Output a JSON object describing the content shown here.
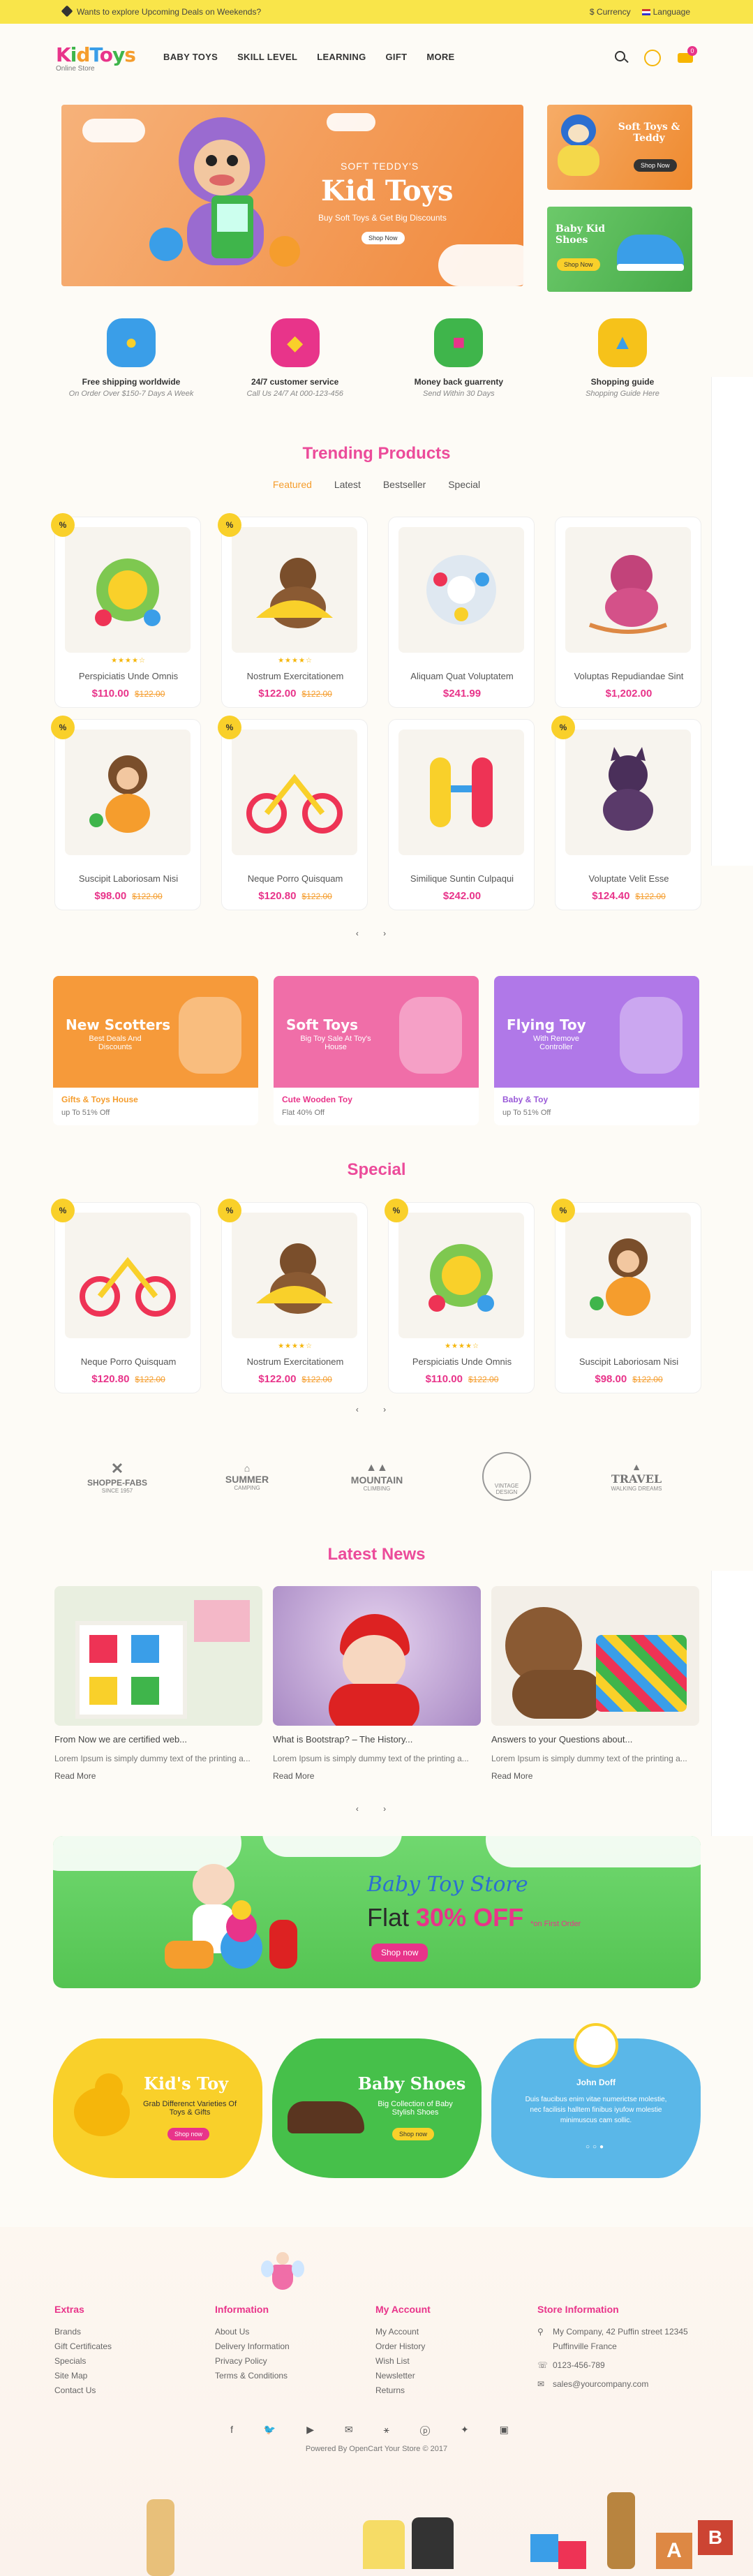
{
  "topbar": {
    "promo": "Wants to explore Upcoming Deals on Weekends?",
    "currency": "$ Currency",
    "language": "Language"
  },
  "header": {
    "logo": "Kid Toys",
    "logo_sub": "Online Store",
    "nav": [
      "BABY TOYS",
      "SKILL LEVEL",
      "LEARNING",
      "GIFT",
      "MORE"
    ],
    "cart_count": "0"
  },
  "hero": {
    "kicker": "SOFT TEDDY'S",
    "title": "Kid Toys",
    "subtitle": "Buy Soft Toys & Get Big Discounts",
    "button": "Shop Now"
  },
  "side_banners": [
    {
      "title": "Soft Toys & Teddy",
      "button": "Shop Now"
    },
    {
      "title": "Baby Kid Shoes",
      "button": "Shop Now"
    }
  ],
  "features": [
    {
      "title": "Free shipping worldwide",
      "sub": "On Order Over $150-7 Days A Week",
      "color": "#3a9ee8"
    },
    {
      "title": "24/7 customer service",
      "sub": "Call Us 24/7 At 000-123-456",
      "color": "#e8348a"
    },
    {
      "title": "Money back guarrenty",
      "sub": "Send Within 30 Days",
      "color": "#3fb54b"
    },
    {
      "title": "Shopping guide",
      "sub": "Shopping Guide Here",
      "color": "#f6c21a"
    }
  ],
  "trending": {
    "title": "Trending Products",
    "tabs": [
      "Featured",
      "Latest",
      "Bestseller",
      "Special"
    ],
    "products": [
      {
        "name": "Perspiciatis Unde Omnis",
        "price": "$110.00",
        "old": "$122.00",
        "badge": "%",
        "stars": "★★★★☆"
      },
      {
        "name": "Nostrum Exercitationem",
        "price": "$122.00",
        "old": "$122.00",
        "badge": "%",
        "stars": "★★★★☆"
      },
      {
        "name": "Aliquam Quat Voluptatem",
        "price": "$241.99",
        "old": "",
        "badge": "",
        "stars": ""
      },
      {
        "name": "Voluptas Repudiandae Sint",
        "price": "$1,202.00",
        "old": "",
        "badge": "",
        "stars": ""
      },
      {
        "name": "Suscipit Laboriosam Nisi",
        "price": "$98.00",
        "old": "$122.00",
        "badge": "%",
        "stars": ""
      },
      {
        "name": "Neque Porro Quisquam",
        "price": "$120.80",
        "old": "$122.00",
        "badge": "%",
        "stars": ""
      },
      {
        "name": "Similique Suntin Culpaqui",
        "price": "$242.00",
        "old": "",
        "badge": "",
        "stars": ""
      },
      {
        "name": "Voluptate Velit Esse",
        "price": "$124.40",
        "old": "$122.00",
        "badge": "%",
        "stars": ""
      }
    ]
  },
  "categories": [
    {
      "title": "New Scotters",
      "sub": "Best Deals And Discounts",
      "b1": "Gifts & Toys House",
      "b2": "up To 51% Off",
      "color": "#f69a3a",
      "b1color": "#f59d2d"
    },
    {
      "title": "Soft Toys",
      "sub": "Big Toy Sale At Toy's House",
      "b1": "Cute Wooden Toy",
      "b2": "Flat 40% Off",
      "color": "#f06ea8",
      "b1color": "#e8348a"
    },
    {
      "title": "Flying Toy",
      "sub": "With Remove Controller",
      "b1": "Baby & Toy",
      "b2": "up To 51% Off",
      "color": "#b078e8",
      "b1color": "#9a5ad8"
    }
  ],
  "special": {
    "title": "Special",
    "products": [
      {
        "name": "Neque Porro Quisquam",
        "price": "$120.80",
        "old": "$122.00",
        "badge": "%",
        "stars": ""
      },
      {
        "name": "Nostrum Exercitationem",
        "price": "$122.00",
        "old": "$122.00",
        "badge": "%",
        "stars": "★★★★☆"
      },
      {
        "name": "Perspiciatis Unde Omnis",
        "price": "$110.00",
        "old": "$122.00",
        "badge": "%",
        "stars": "★★★★☆"
      },
      {
        "name": "Suscipit Laboriosam Nisi",
        "price": "$98.00",
        "old": "$122.00",
        "badge": "%",
        "stars": ""
      }
    ]
  },
  "brands": [
    {
      "name": "SHOPPE-FABS",
      "sub": "SINCE 1957"
    },
    {
      "name": "SUMMER",
      "sub": "CAMPING"
    },
    {
      "name": "MOUNTAIN",
      "sub": "CLIMBING"
    },
    {
      "name": "",
      "sub": "VINTAGE DESIGN"
    },
    {
      "name": "TRAVEL",
      "sub": "WALKING DREAMS"
    }
  ],
  "news": {
    "title": "Latest News",
    "items": [
      {
        "title": "From Now we are certified web...",
        "desc": "Lorem Ipsum is simply dummy text of the printing a...",
        "more": "Read More"
      },
      {
        "title": "What is Bootstrap? – The History...",
        "desc": "Lorem Ipsum is simply dummy text of the printing a...",
        "more": "Read More"
      },
      {
        "title": "Answers to your Questions about...",
        "desc": "Lorem Ipsum is simply dummy text of the printing a...",
        "more": "Read More"
      }
    ]
  },
  "promo": {
    "title": "Baby Toy Store",
    "flat": "Flat",
    "off": "30% OFF",
    "note": "*on First Order",
    "button": "Shop now"
  },
  "blobs": [
    {
      "title": "Kid's Toy",
      "sub": "Grab Differenct Varieties Of Toys & Gifts",
      "button": "Shop now"
    },
    {
      "title": "Baby Shoes",
      "sub": "Big Collection of Baby Stylish Shoes",
      "button": "Shop now"
    },
    {
      "name": "John Doff",
      "text": "Duis faucibus enim vitae numerictse molestie, nec facilisis halltem finibus iyufow molestie minimuscus cam sollic."
    }
  ],
  "footer": {
    "cols": [
      {
        "title": "Extras",
        "items": [
          "Brands",
          "Gift Certificates",
          "Specials",
          "Site Map",
          "Contact Us"
        ]
      },
      {
        "title": "Information",
        "items": [
          "About Us",
          "Delivery Information",
          "Privacy Policy",
          "Terms & Conditions"
        ]
      },
      {
        "title": "My Account",
        "items": [
          "My Account",
          "Order History",
          "Wish List",
          "Newsletter",
          "Returns"
        ]
      },
      {
        "title": "Store Information",
        "items": [
          "My Company, 42 Puffin street 12345 Puffinville France",
          "0123-456-789",
          "sales@yourcompany.com"
        ]
      }
    ],
    "social": "f 🐦 ▶ ✉ ⚹ ⓟ ✦ ▣",
    "copyright": "Powered By OpenCart Your Store © 2017"
  }
}
